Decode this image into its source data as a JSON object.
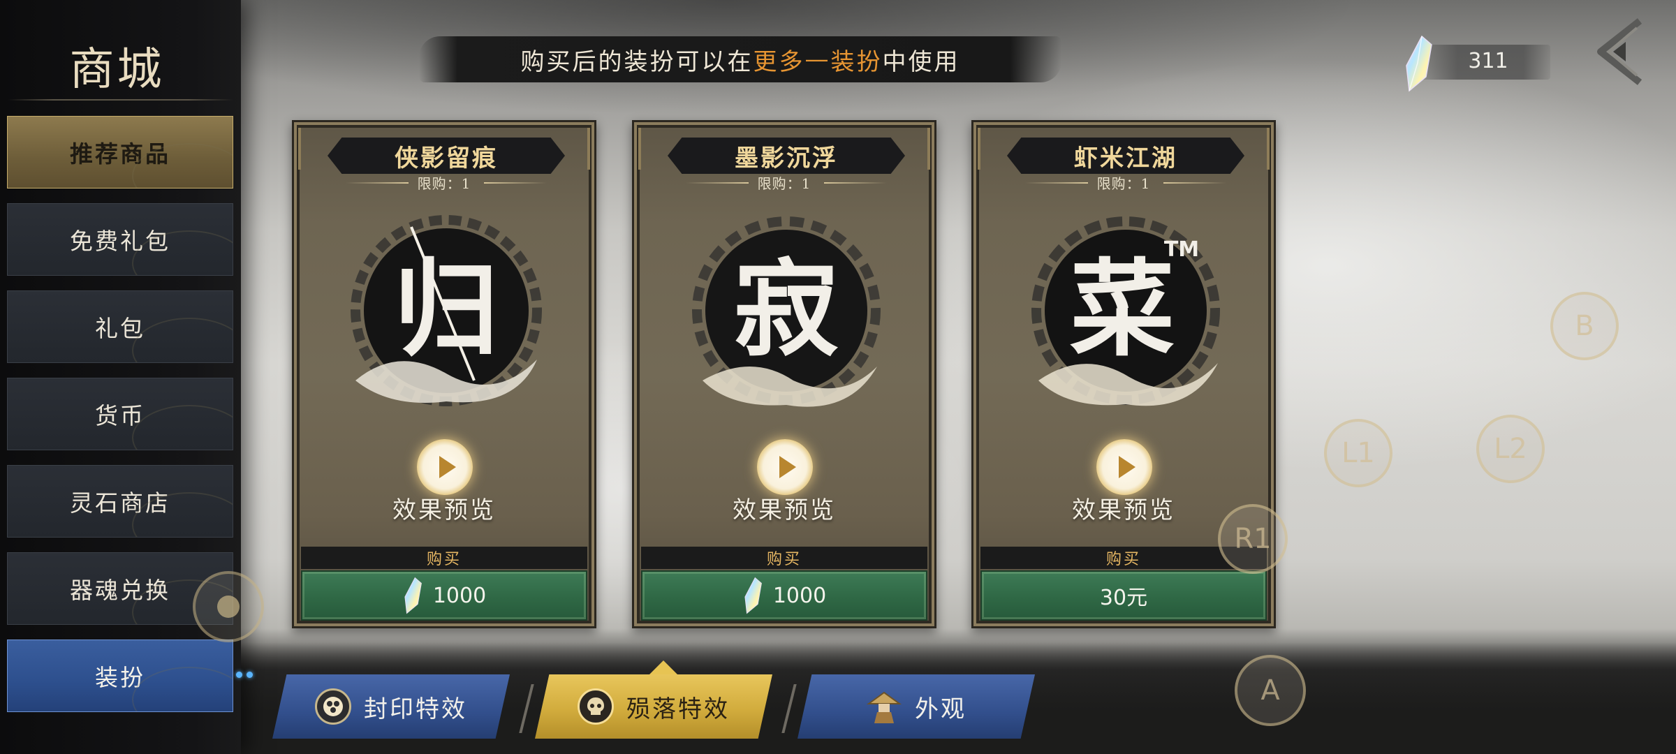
{
  "sidebar": {
    "title": "商城",
    "items": [
      {
        "label": "推荐商品"
      },
      {
        "label": "免费礼包"
      },
      {
        "label": "礼包"
      },
      {
        "label": "货币"
      },
      {
        "label": "灵石商店"
      },
      {
        "label": "器魂兑换"
      },
      {
        "label": "装扮"
      }
    ]
  },
  "banner": {
    "prefix": "购买后的装扮可以在",
    "highlight1": "更多",
    "dash": "—",
    "highlight2": "装扮",
    "suffix": "中使用"
  },
  "currency": {
    "icon": "crystal-icon",
    "value": "311"
  },
  "cards": [
    {
      "title": "侠影留痕",
      "limit": "限购：1",
      "emblem_char": "归",
      "preview_label": "效果预览",
      "buy_label": "购买",
      "price": "1000",
      "price_icon": "crystal-icon"
    },
    {
      "title": "墨影沉浮",
      "limit": "限购：1",
      "emblem_char": "寂",
      "preview_label": "效果预览",
      "buy_label": "购买",
      "price": "1000",
      "price_icon": "crystal-icon"
    },
    {
      "title": "虾米江湖",
      "limit": "限购：1",
      "emblem_char": "菜",
      "emblem_mark": "TM",
      "preview_label": "效果预览",
      "buy_label": "购买",
      "price": "30元"
    }
  ],
  "tabs": [
    {
      "label": "封印特效",
      "icon": "seal-icon"
    },
    {
      "label": "殒落特效",
      "icon": "skull-icon"
    },
    {
      "label": "外观",
      "icon": "straw-hat-figure-icon"
    }
  ],
  "gamepad": {
    "b": "B",
    "l1": "L1",
    "l2": "L2",
    "r1": "R1",
    "a": "A"
  },
  "colors": {
    "highlight_orange": "#e79532",
    "title_gold": "#f0d79b",
    "buy_green": "#2f6845",
    "active_tab_gold": "#d2ac3d",
    "active_nav_blue": "#2d4f8d"
  }
}
